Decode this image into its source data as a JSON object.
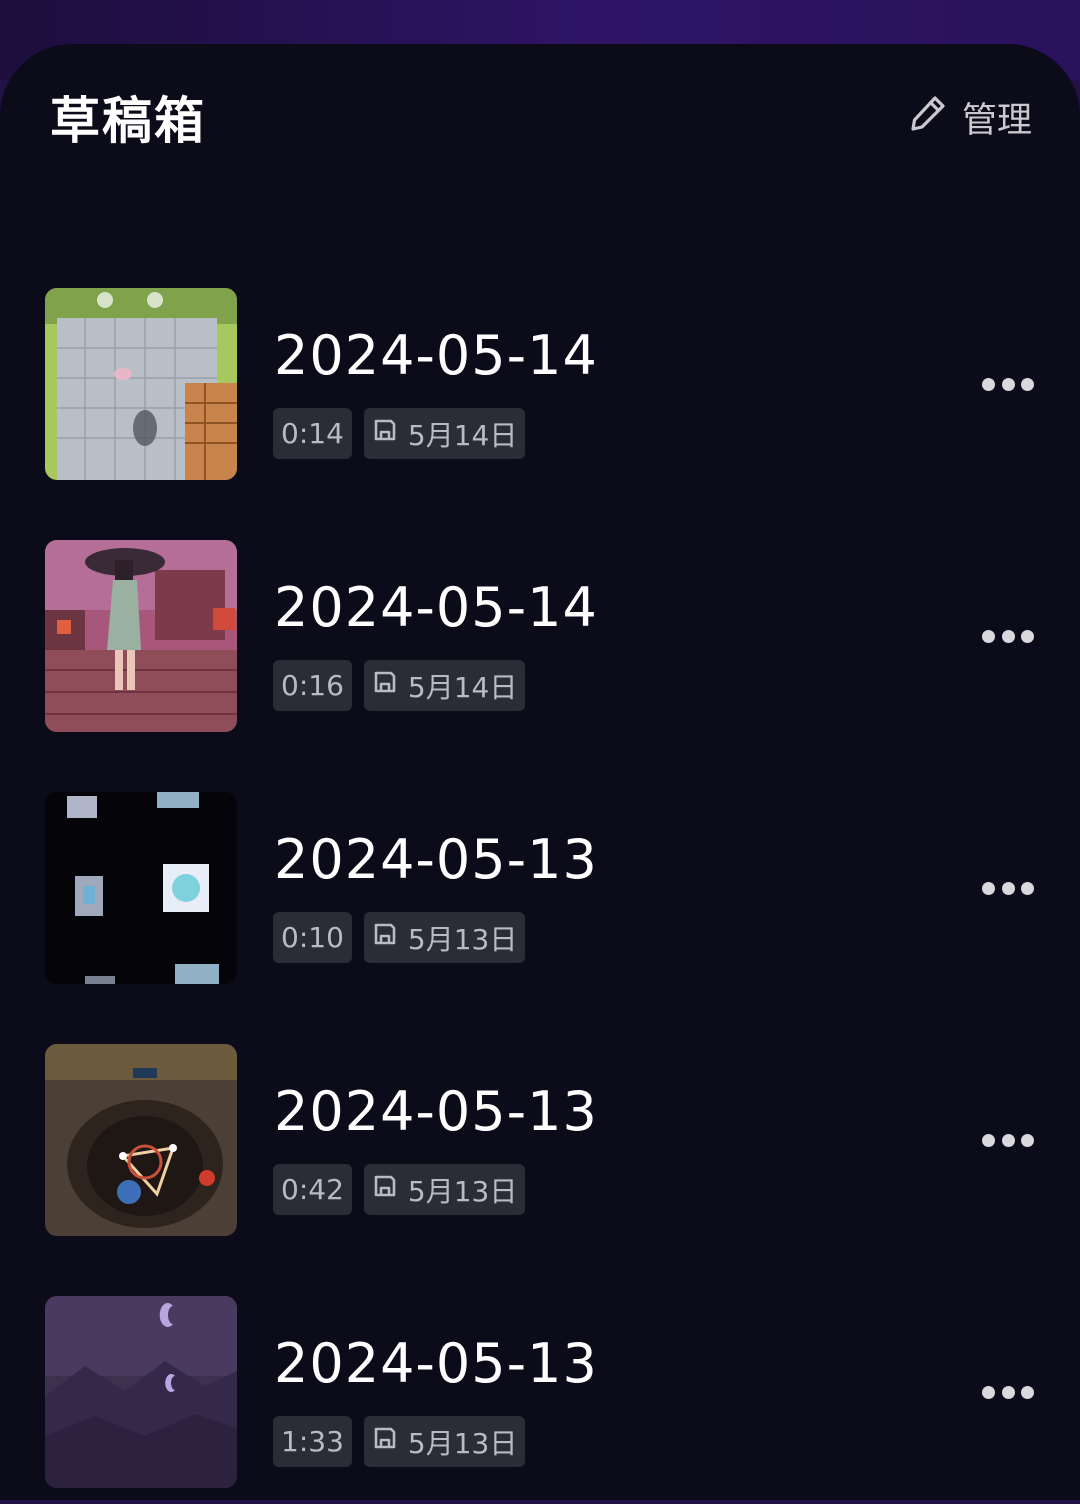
{
  "header": {
    "title": "草稿箱",
    "manage_label": "管理",
    "manage_icon": "pencil-icon"
  },
  "drafts": [
    {
      "title": "2024-05-14",
      "duration": "0:14",
      "saved": "5月14日",
      "thumb": "game-courtyard-scene"
    },
    {
      "title": "2024-05-14",
      "duration": "0:16",
      "saved": "5月14日",
      "thumb": "qipao-character-scene"
    },
    {
      "title": "2024-05-13",
      "duration": "0:10",
      "saved": "5月13日",
      "thumb": "floating-cards-scene"
    },
    {
      "title": "2024-05-13",
      "duration": "0:42",
      "saved": "5月13日",
      "thumb": "arena-battle-scene"
    },
    {
      "title": "2024-05-13",
      "duration": "1:33",
      "saved": "5月13日",
      "thumb": "purple-night-scene"
    }
  ],
  "colors": {
    "background": "#0b0b1a",
    "accent_top": "#2f1466",
    "badge_bg": "#2b2c36"
  }
}
